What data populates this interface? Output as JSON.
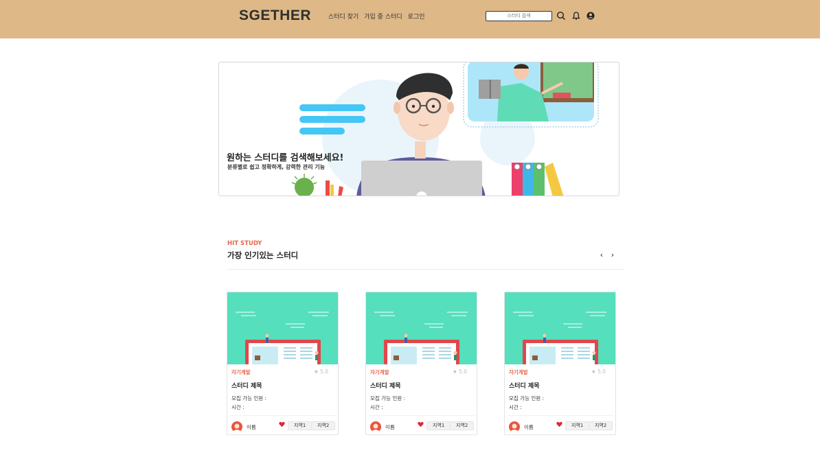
{
  "header": {
    "logo": "SGETHER",
    "nav": [
      "스터디 찾기",
      "가입 중 스터디",
      "로그인"
    ],
    "search_placeholder": "스터디 검색"
  },
  "banner": {
    "title": "원하는 스터디를 검색해보세요!",
    "subtitle": "분류별로 쉽고 정확하게, 강력한 관리 기능"
  },
  "section": {
    "eyebrow": "HIT STUDY",
    "title": "가장 인기있는 스터디",
    "prev": "‹",
    "next": "›"
  },
  "cards": [
    {
      "category": "자기계발",
      "rating": "5.0",
      "title": "스터디 제목",
      "capacity": "모집 가능 인원 :",
      "time": "시간 :",
      "author": "이름",
      "tags": [
        "지역1",
        "지역2"
      ]
    },
    {
      "category": "자기계발",
      "rating": "5.0",
      "title": "스터디 제목",
      "capacity": "모집 가능 인원 :",
      "time": "시간 :",
      "author": "이름",
      "tags": [
        "지역1",
        "지역2"
      ]
    },
    {
      "category": "자기계발",
      "rating": "5.0",
      "title": "스터디 제목",
      "capacity": "모집 가능 인원 :",
      "time": "시간 :",
      "author": "이름",
      "tags": [
        "지역1",
        "지역2"
      ]
    }
  ],
  "colors": {
    "header_bg": "#deb887",
    "accent": "#e8664a",
    "card_image_bg": "#55dfbc"
  },
  "icons": [
    "search-icon",
    "bell-icon",
    "user-icon",
    "star-icon",
    "heart-icon",
    "chevron-left-icon",
    "chevron-right-icon"
  ]
}
